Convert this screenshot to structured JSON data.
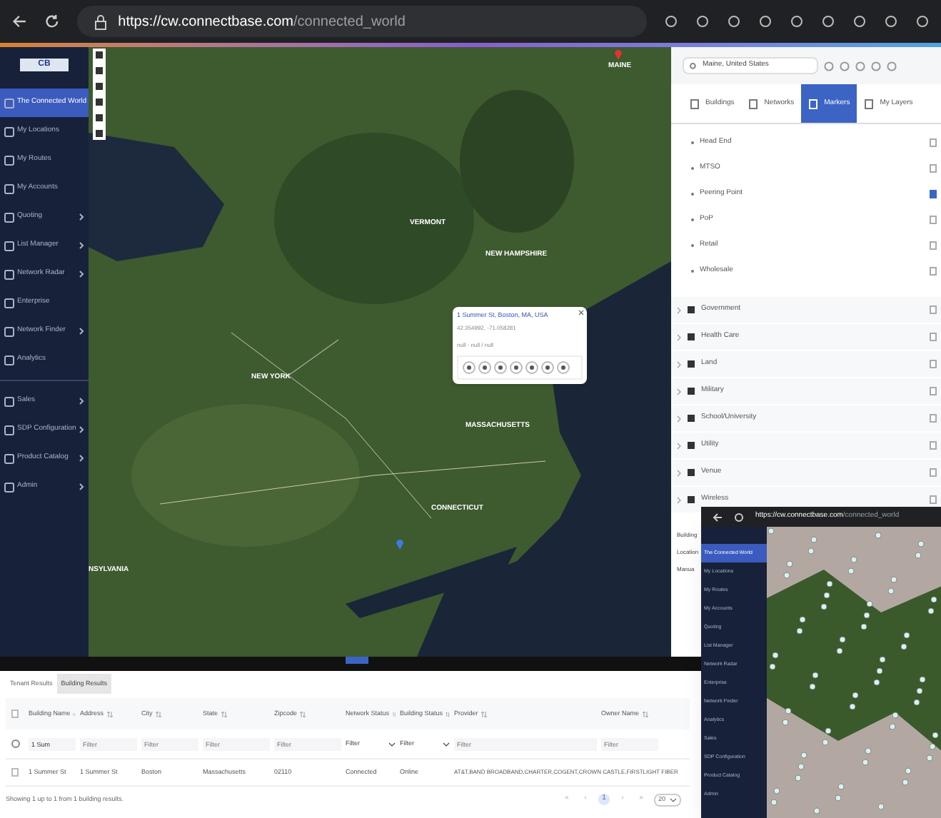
{
  "browser": {
    "url_host": "https://cw.connectbase.com",
    "url_path": "/connected_world"
  },
  "sidebar": {
    "logo": "CB",
    "items": [
      {
        "label": "The Connected World",
        "selected": true,
        "expandable": false
      },
      {
        "label": "My Locations",
        "selected": false,
        "expandable": false
      },
      {
        "label": "My Routes",
        "selected": false,
        "expandable": false
      },
      {
        "label": "My Accounts",
        "selected": false,
        "expandable": false
      },
      {
        "label": "Quoting",
        "selected": false,
        "expandable": true
      },
      {
        "label": "List Manager",
        "selected": false,
        "expandable": true
      },
      {
        "label": "Network Radar",
        "selected": false,
        "expandable": true
      },
      {
        "label": "Enterprise",
        "selected": false,
        "expandable": false
      },
      {
        "label": "Network Finder",
        "selected": false,
        "expandable": true
      },
      {
        "label": "Analytics",
        "selected": false,
        "expandable": false
      },
      {
        "label": "Sales",
        "selected": false,
        "expandable": true
      },
      {
        "label": "SDP Configuration",
        "selected": false,
        "expandable": true
      },
      {
        "label": "Product Catalog",
        "selected": false,
        "expandable": true
      },
      {
        "label": "Admin",
        "selected": false,
        "expandable": true
      }
    ]
  },
  "map": {
    "labels": [
      "MAINE",
      "VERMONT",
      "NEW HAMPSHIRE",
      "NEW YORK",
      "MASSACHUSETTS",
      "CONNECTICUT",
      "NSYLVANIA"
    ],
    "popup": {
      "address": "1 Summer St, Boston, MA, USA",
      "coordinates": "42.354992, -71.058281",
      "detail": "null - null / null"
    }
  },
  "panel": {
    "search": {
      "value": "Maine, United States"
    },
    "tabs": [
      {
        "label": "Buildings",
        "selected": false
      },
      {
        "label": "Networks",
        "selected": false
      },
      {
        "label": "Markers",
        "selected": true
      },
      {
        "label": "My Layers",
        "selected": false
      }
    ],
    "marker_types": [
      {
        "label": "Head End",
        "checked": false
      },
      {
        "label": "MTSO",
        "checked": false
      },
      {
        "label": "Peering Point",
        "checked": true
      },
      {
        "label": "PoP",
        "checked": false
      },
      {
        "label": "Retail",
        "checked": false
      },
      {
        "label": "Wholesale",
        "checked": false
      }
    ],
    "categories": [
      {
        "label": "Government",
        "checked": false
      },
      {
        "label": "Health Care",
        "checked": false
      },
      {
        "label": "Land",
        "checked": false
      },
      {
        "label": "Military",
        "checked": false
      },
      {
        "label": "School/University",
        "checked": false
      },
      {
        "label": "Utility",
        "checked": false
      },
      {
        "label": "Venue",
        "checked": false
      },
      {
        "label": "Wireless",
        "checked": false
      }
    ],
    "lower_labels": [
      "Building",
      "Location",
      "Manua"
    ]
  },
  "results": {
    "tabs": [
      {
        "label": "Tenant Results",
        "selected": false
      },
      {
        "label": "Building Results",
        "selected": true
      }
    ],
    "header_checked": false,
    "columns": [
      "Building Name",
      "Address",
      "City",
      "State",
      "Zipcode",
      "Network Status",
      "Building Status",
      "Provider",
      "Owner Name"
    ],
    "filters": [
      {
        "kind": "text",
        "value": "1 Sum"
      },
      {
        "kind": "text",
        "placeholder": "Filter"
      },
      {
        "kind": "text",
        "placeholder": "Filter"
      },
      {
        "kind": "text",
        "placeholder": "Filter"
      },
      {
        "kind": "text",
        "placeholder": "Filter"
      },
      {
        "kind": "select",
        "value": "Filter"
      },
      {
        "kind": "select",
        "value": "Filter"
      },
      {
        "kind": "text",
        "placeholder": "Filter"
      },
      {
        "kind": "text",
        "placeholder": "Filter"
      }
    ],
    "rows": [
      {
        "checked": false,
        "cells": [
          "1 Summer St",
          "1 Summer St",
          "Boston",
          "Massachusetts",
          "02110",
          "Connected",
          "Online",
          "AT&T,BAND BROADBAND,CHARTER,COGENT,CROWN CASTLE,FIRSTLIGHT FIBER",
          ""
        ]
      }
    ],
    "footer": "Showing 1 up to 1 from 1 building results.",
    "pages": [
      {
        "label": "«",
        "selected": false
      },
      {
        "label": "‹",
        "selected": false
      },
      {
        "label": "1",
        "selected": true
      },
      {
        "label": "›",
        "selected": false
      },
      {
        "label": "»",
        "selected": false
      }
    ],
    "page_size": "20"
  },
  "inset": {
    "url_host": "https://cw.connectbase.com",
    "url_path": "/connected_world",
    "items": [
      {
        "label": "The Connected World",
        "selected": true
      },
      {
        "label": "My Locations",
        "selected": false
      },
      {
        "label": "My Routes",
        "selected": false
      },
      {
        "label": "My Accounts",
        "selected": false
      },
      {
        "label": "Quoting",
        "selected": false
      },
      {
        "label": "List Manager",
        "selected": false
      },
      {
        "label": "Network Radar",
        "selected": false
      },
      {
        "label": "Enterprise",
        "selected": false
      },
      {
        "label": "Network Finder",
        "selected": false
      },
      {
        "label": "Analytics",
        "selected": false
      },
      {
        "label": "Sales",
        "selected": false
      },
      {
        "label": "SDP Configuration",
        "selected": false
      },
      {
        "label": "Product Catalog",
        "selected": false
      },
      {
        "label": "Admin",
        "selected": false
      }
    ]
  }
}
